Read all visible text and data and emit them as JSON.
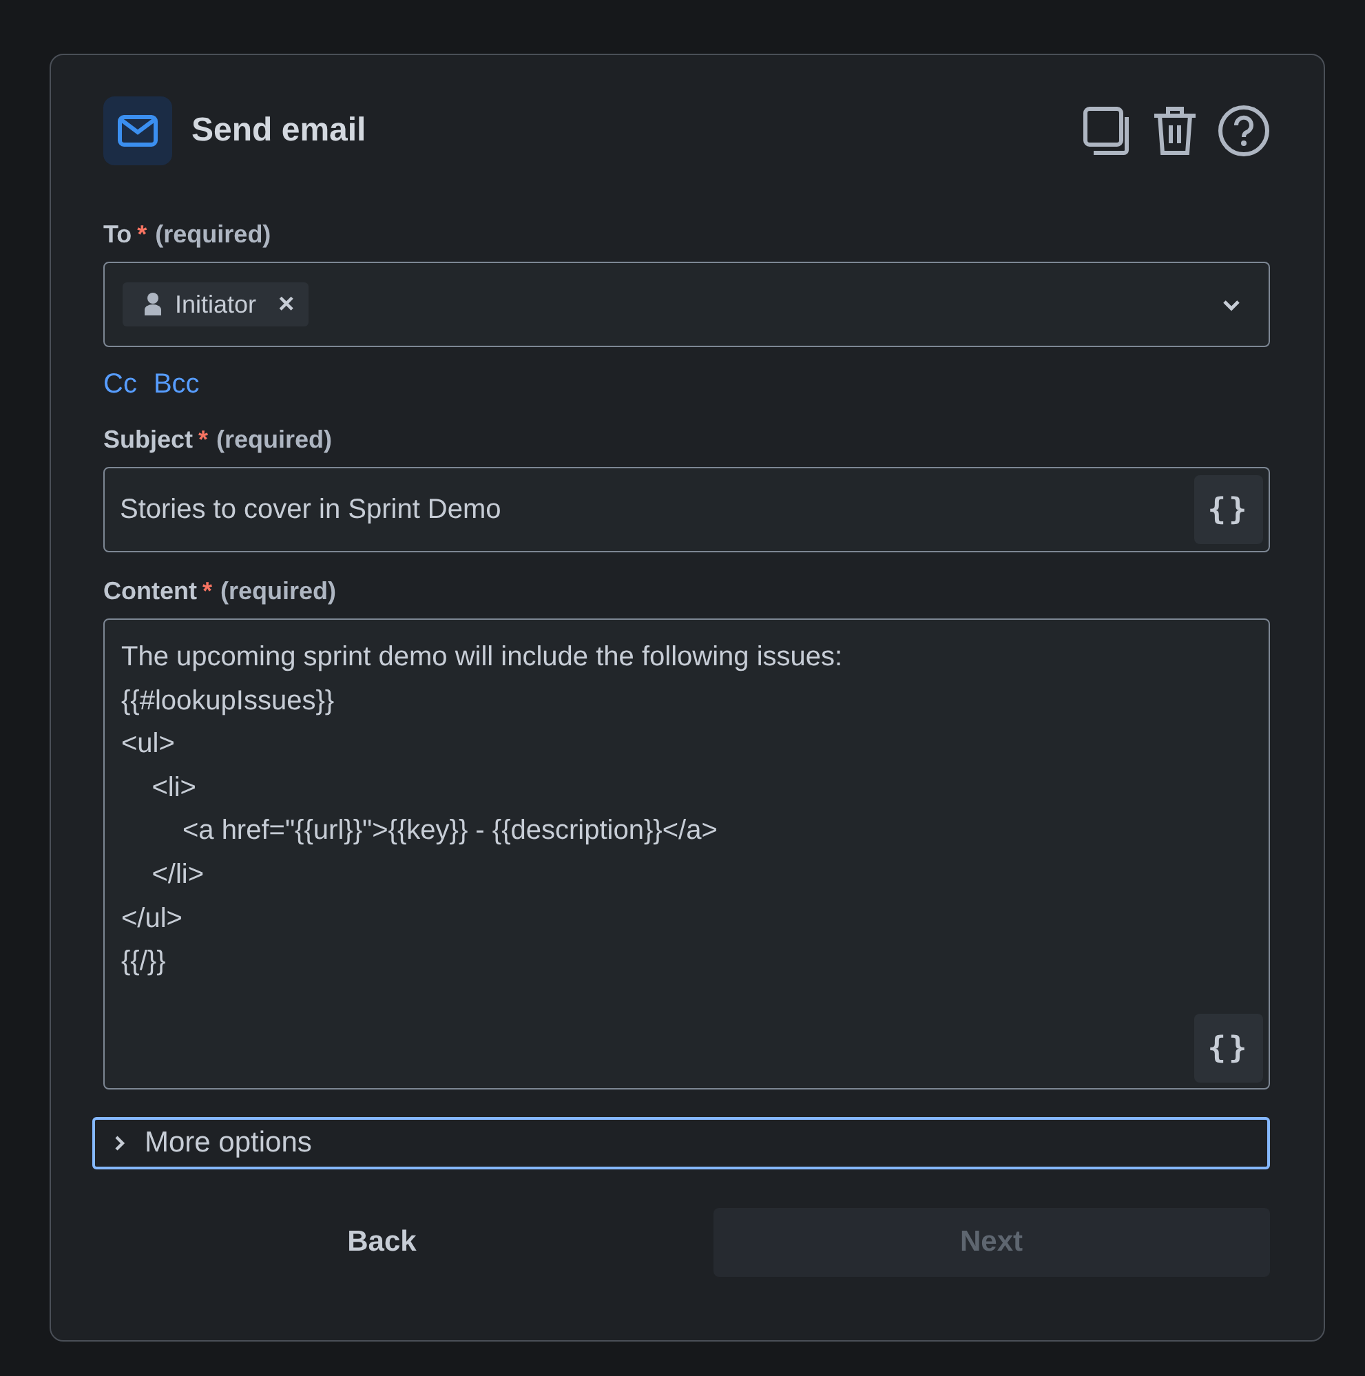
{
  "header": {
    "title": "Send email"
  },
  "to": {
    "label": "To",
    "required_mark": "*",
    "hint": "(required)",
    "recipients": [
      {
        "name": "Initiator",
        "remove": "×"
      }
    ]
  },
  "cc_links": [
    "Cc",
    "Bcc"
  ],
  "subject": {
    "label": "Subject",
    "required_mark": "*",
    "hint": "(required)",
    "value": "Stories to cover in Sprint Demo",
    "insert_button": "{}"
  },
  "content": {
    "label": "Content",
    "required_mark": "*",
    "hint": "(required)",
    "lines": [
      "The upcoming sprint demo will include the following issues:",
      "{{#lookupIssues}}",
      "<ul>",
      "    <li>",
      "        <a href=\"{{url}}\">{{key}} - {{description}}</a>",
      "    </li>",
      "</ul>",
      "{{/}}"
    ],
    "insert_button": "{}"
  },
  "more_options": {
    "label": "More options",
    "expanded": false
  },
  "buttons": [
    {
      "label": "Back",
      "disabled": false
    },
    {
      "label": "Next",
      "disabled": true
    }
  ]
}
